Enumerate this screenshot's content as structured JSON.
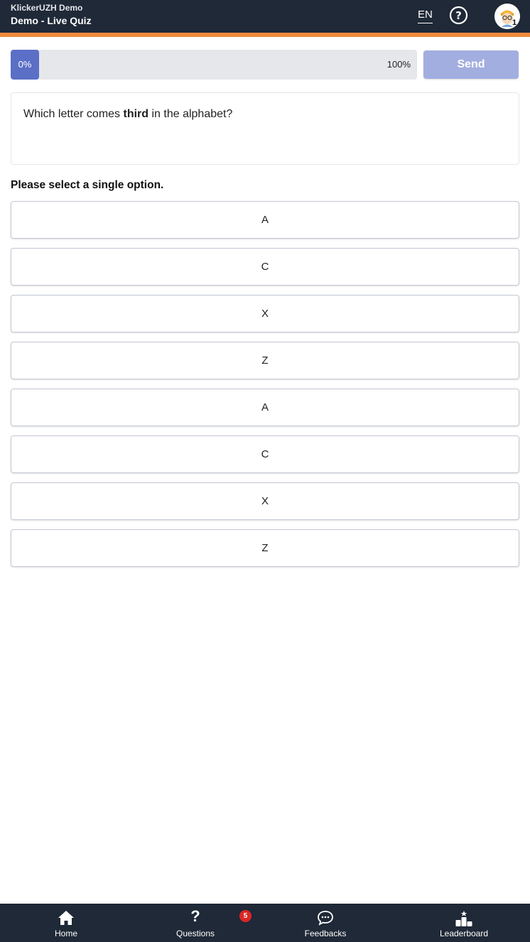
{
  "header": {
    "course_name": "KlickerUZH Demo",
    "quiz_name": "Demo - Live Quiz",
    "language": "EN",
    "avatar_badge": "1",
    "colors": {
      "bar": "#1f2937",
      "accent": "#f08a3c"
    }
  },
  "progress": {
    "percent": 0,
    "start_label": "0%",
    "end_label": "100%"
  },
  "send_button": {
    "label": "Send"
  },
  "question": {
    "text_before": "Which letter comes ",
    "text_bold": "third",
    "text_after": " in the alphabet?"
  },
  "instruction": "Please select a single option.",
  "options": [
    {
      "label": "A"
    },
    {
      "label": "C"
    },
    {
      "label": "X"
    },
    {
      "label": "Z"
    },
    {
      "label": "A"
    },
    {
      "label": "C"
    },
    {
      "label": "X"
    },
    {
      "label": "Z"
    }
  ],
  "bottom_nav": {
    "items": [
      {
        "label": "Home",
        "icon": "home-icon"
      },
      {
        "label": "Questions",
        "icon": "question-icon",
        "badge": "5"
      },
      {
        "label": "Feedbacks",
        "icon": "chat-icon"
      },
      {
        "label": "Leaderboard",
        "icon": "podium-icon"
      }
    ]
  }
}
